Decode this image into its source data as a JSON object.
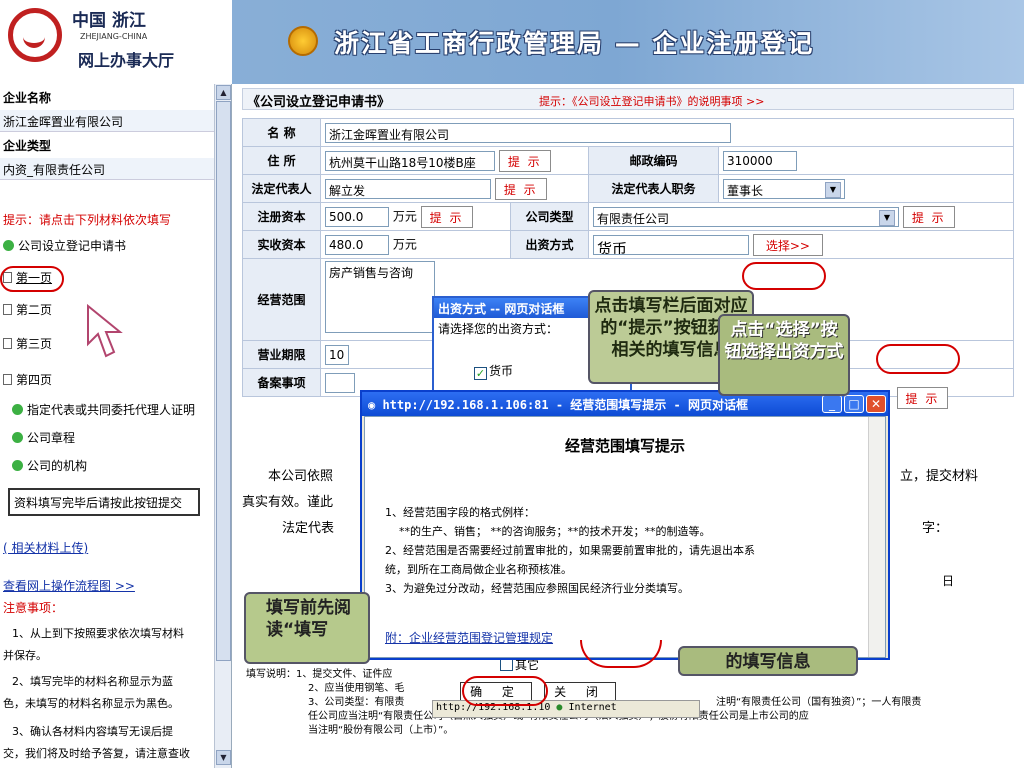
{
  "header": {
    "logo_cn": "中国 浙江",
    "logo_en": "ZHEJIANG-CHINA",
    "logo_sub": "网上办事大厅",
    "title": "浙江省工商行政管理局 — 企业注册登记"
  },
  "sidebar": {
    "company_name_label": "企业名称",
    "company_name_value": "浙江金晖置业有限公司",
    "company_type_label": "企业类型",
    "company_type_value": "内资_有限责任公司",
    "hint": "提示：请点击下列材料依次填写",
    "items": [
      {
        "label": "公司设立登记申请书"
      },
      {
        "label": "第一页"
      },
      {
        "label": "第二页"
      },
      {
        "label": "第三页"
      },
      {
        "label": "第四页"
      },
      {
        "label": "指定代表或共同委托代理人证明"
      },
      {
        "label": "公司章程"
      },
      {
        "label": "公司的机构"
      }
    ],
    "submit_label": "资料填写完毕后请按此按钮提交",
    "upload_link": "( 相关材料上传)",
    "flow_link": "查看网上操作流程图 >>",
    "notice_title": "注意事项：",
    "notice_1": "1、从上到下按照要求依次填写材料",
    "notice_1b": "并保存。",
    "notice_2": "2、填写完毕的材料名称显示为蓝",
    "notice_2b": "色，未填写的材料名称显示为黑色。",
    "notice_3": "3、确认各材料内容填写无误后提",
    "notice_3b": "交，我们将及时给予答复，请注意查收"
  },
  "form": {
    "title": "《公司设立登记申请书》",
    "hint": "提示：《公司设立登记申请书》的说明事项 >>",
    "name_label": "名 称",
    "name_value": "浙江金晖置业有限公司",
    "address_label": "住 所",
    "address_value": "杭州莫干山路18号10楼B座",
    "tip_label": "提 示",
    "postcode_label": "邮政编码",
    "postcode_value": "310000",
    "legal_rep_label": "法定代表人",
    "legal_rep_value": "解立发",
    "legal_rep_title_label": "法定代表人职务",
    "legal_rep_title_value": "董事长",
    "reg_capital_label": "注册资本",
    "reg_capital_value": "500.0",
    "unit": "万元",
    "company_type_label": "公司类型",
    "company_type_value": "有限责任公司",
    "paid_capital_label": "实收资本",
    "paid_capital_value": "480.0",
    "funding_label": "出资方式",
    "funding_value": "货币",
    "choose_label": "选择>>",
    "scope_label": "经营范围",
    "scope_value": "房产销售与咨询",
    "term_label": "营业期限",
    "term_value": "10",
    "record_label": "备案事项",
    "statement_1": "本公司依照",
    "statement_1_end": "立，提交材料",
    "statement_2": "真实有效。谨此",
    "statement_3": "法定代表",
    "statement_3_end": "字：",
    "date_char": "日",
    "notes_label": "填写说明：",
    "notes_1": "1、提交文件、证件应",
    "notes_2": "2、应当使用钢笔、毛",
    "notes_3a": "3、公司类型：有限责",
    "notes_3b": "注明“有限责任公司（国有独资）”；一人有限责",
    "notes_3c": "任公司应当注明“有限责任公司（自然人独资）”或“有限责任公司（法人独资）”；股份有限责任公司是上市公司的应",
    "notes_3d": "当注明“股份有限公司（上市）”。"
  },
  "callouts": {
    "left": "填写前先阅读“填写",
    "c1": "点击填写栏后面对应的“提示”按钮获取相关的填写信息",
    "c2": "点击“选择”按钮选择出资方式",
    "c3": "的填写信息"
  },
  "funding_dialog": {
    "title": "出资方式 -- 网页对话框",
    "prompt": "请选择您的出资方式：",
    "option": "货币",
    "other": "其它",
    "ok": "确 定",
    "close": "关 闭"
  },
  "scope_window": {
    "title": "http://192.168.1.106:81 - 经营范围填写提示 - 网页对话框",
    "heading": "经营范围填写提示",
    "line1": "1、经营范围字段的格式例样：",
    "line2": "**的生产、销售； **的咨询服务；**的技术开发；**的制造等。",
    "line3": "2、经营范围是否需要经过前置审批的，如果需要前置审批的，请先退出本系",
    "line4": "统，到所在工商局做企业名称预核准。",
    "line5": "3、为避免过分改动，经营范围应参照国民经济行业分类填写。",
    "link": "附：企业经营范围登记管理规定"
  },
  "status_bar": {
    "url": "http://192.168.1.10",
    "zone": "Internet"
  }
}
